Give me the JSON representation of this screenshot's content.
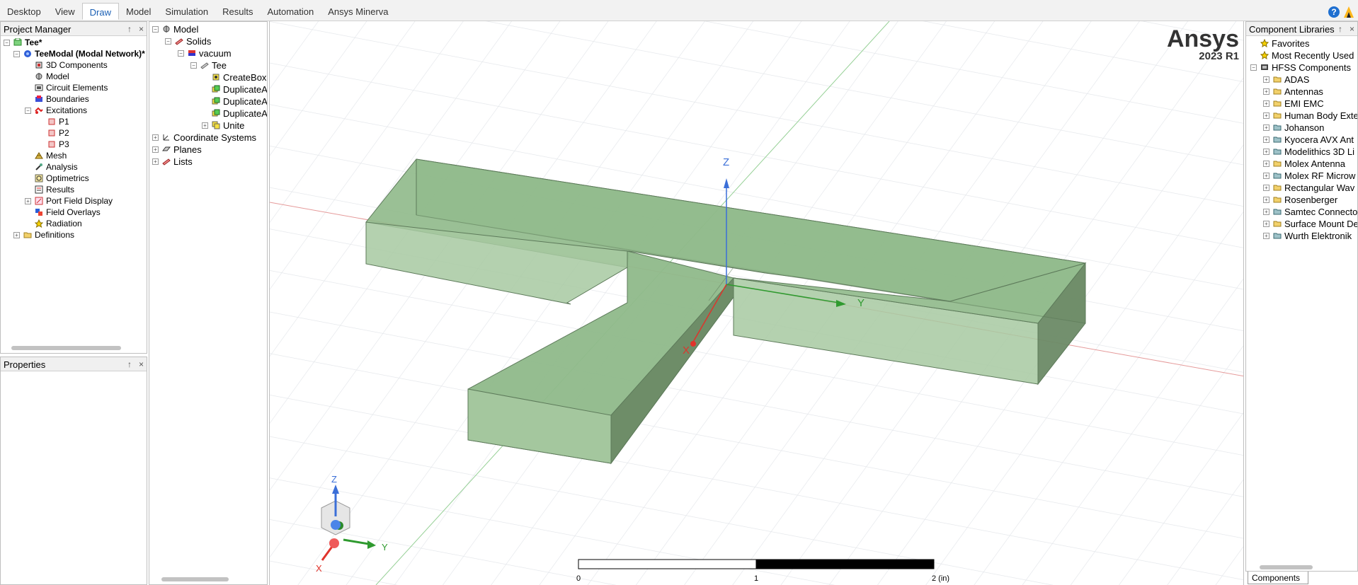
{
  "ribbon": {
    "tabs": [
      "Desktop",
      "View",
      "Draw",
      "Model",
      "Simulation",
      "Results",
      "Automation",
      "Ansys Minerva"
    ],
    "active_tab": "Draw"
  },
  "project_manager": {
    "title": "Project Manager",
    "pin": "↑",
    "close": "×",
    "items": [
      {
        "label": "Tee*",
        "icon": "project-icon",
        "bold": true
      },
      {
        "label": "TeeModal (Modal Network)*",
        "icon": "design-icon",
        "bold": true
      },
      {
        "label": "3D Components",
        "icon": "component-icon"
      },
      {
        "label": "Model",
        "icon": "model-icon"
      },
      {
        "label": "Circuit Elements",
        "icon": "circuit-icon"
      },
      {
        "label": "Boundaries",
        "icon": "boundary-icon"
      },
      {
        "label": "Excitations",
        "icon": "excitation-icon"
      },
      {
        "label": "P1",
        "icon": "port-icon"
      },
      {
        "label": "P2",
        "icon": "port-icon"
      },
      {
        "label": "P3",
        "icon": "port-icon"
      },
      {
        "label": "Mesh",
        "icon": "mesh-icon"
      },
      {
        "label": "Analysis",
        "icon": "analysis-icon"
      },
      {
        "label": "Optimetrics",
        "icon": "optimetrics-icon"
      },
      {
        "label": "Results",
        "icon": "results-icon"
      },
      {
        "label": "Port Field Display",
        "icon": "port-field-icon"
      },
      {
        "label": "Field Overlays",
        "icon": "field-overlay-icon"
      },
      {
        "label": "Radiation",
        "icon": "radiation-icon"
      },
      {
        "label": "Definitions",
        "icon": "folder-icon"
      }
    ]
  },
  "properties": {
    "title": "Properties",
    "pin": "↑",
    "close": "×"
  },
  "model_tree": {
    "items": [
      {
        "label": "Model"
      },
      {
        "label": "Solids"
      },
      {
        "label": "vacuum"
      },
      {
        "label": "Tee"
      },
      {
        "label": "CreateBox"
      },
      {
        "label": "DuplicateA"
      },
      {
        "label": "DuplicateA"
      },
      {
        "label": "DuplicateA"
      },
      {
        "label": "Unite"
      },
      {
        "label": "Coordinate Systems"
      },
      {
        "label": "Planes"
      },
      {
        "label": "Lists"
      }
    ]
  },
  "viewport": {
    "brand": "Ansys",
    "version": "2023 R1",
    "axis_z": "Z",
    "axis_y": "Y",
    "axis_x": "X",
    "scale_labels": [
      "0",
      "1",
      "2 (in)"
    ],
    "colors": {
      "solid": "#8fb98a",
      "x_axis": "#e0332b",
      "y_axis": "#2f9a2f",
      "z_axis": "#2f6ad8"
    }
  },
  "component_libraries": {
    "title": "Component Libraries",
    "pin": "↑",
    "close": "×",
    "items": [
      {
        "label": "Favorites"
      },
      {
        "label": "Most Recently Used"
      },
      {
        "label": "HFSS Components"
      },
      {
        "label": "ADAS"
      },
      {
        "label": "Antennas"
      },
      {
        "label": "EMI EMC"
      },
      {
        "label": "Human Body Exte"
      },
      {
        "label": "Johanson"
      },
      {
        "label": "Kyocera AVX Ant"
      },
      {
        "label": "Modelithics 3D Li"
      },
      {
        "label": "Molex Antenna"
      },
      {
        "label": "Molex RF Microw"
      },
      {
        "label": "Rectangular Wav"
      },
      {
        "label": "Rosenberger"
      },
      {
        "label": "Samtec Connecto"
      },
      {
        "label": "Surface Mount De"
      },
      {
        "label": "Wurth Elektronik"
      }
    ],
    "bottom_tab": "Components"
  }
}
